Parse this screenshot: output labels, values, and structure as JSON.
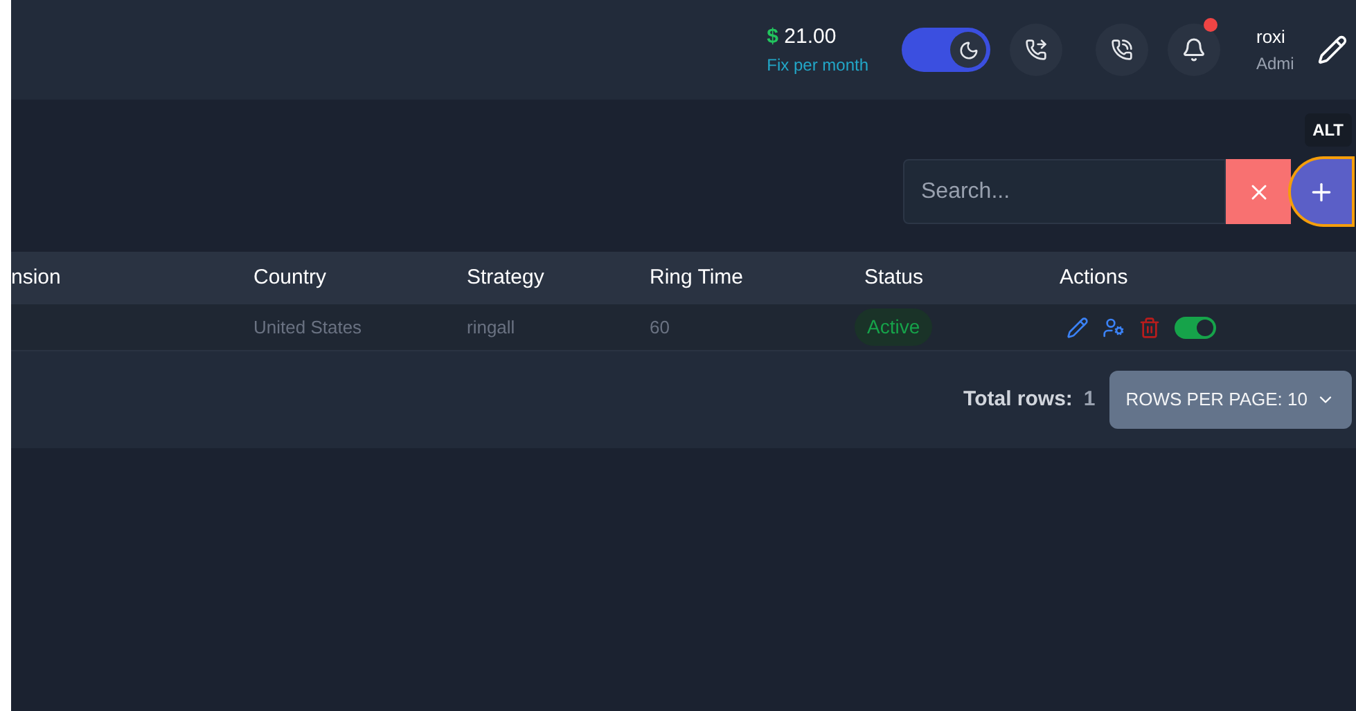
{
  "header": {
    "balance": {
      "currency": "$",
      "amount": "21.00",
      "caption": "Fix per month"
    },
    "dark_mode": {
      "on": true
    },
    "notification": {
      "unread": true
    },
    "user": {
      "name": "roxi",
      "role": "Admi"
    }
  },
  "shortcut_badge": "ALT",
  "search": {
    "placeholder": "Search..."
  },
  "table": {
    "columns": [
      "nsion",
      "Country",
      "Strategy",
      "Ring Time",
      "Status",
      "Actions"
    ],
    "rows": [
      {
        "cells": [
          "",
          "United States",
          "ringall",
          "60"
        ],
        "status": "Active",
        "enabled": true
      }
    ]
  },
  "footer": {
    "total_label": "Total rows:",
    "total": "1",
    "rows_per_page": "ROWS PER PAGE: 10"
  }
}
